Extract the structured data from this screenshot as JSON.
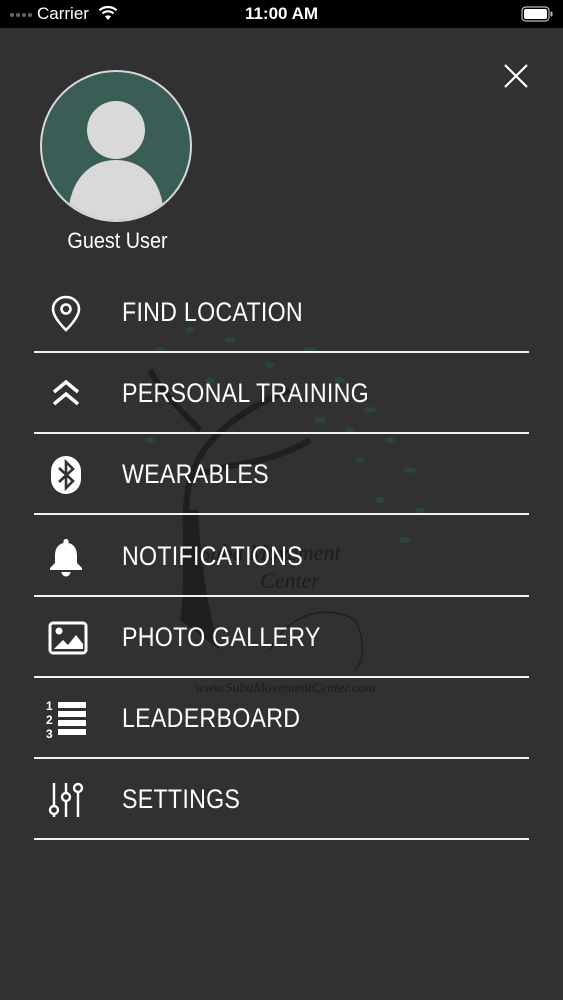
{
  "status_bar": {
    "carrier": "Carrier",
    "time": "11:00 AM"
  },
  "user": {
    "name": "Guest User"
  },
  "watermark": {
    "title_line1": "Suba Movement",
    "title_line2": "Center",
    "url": "www.SubaMovementCenter.com"
  },
  "menu": [
    {
      "label": "FIND LOCATION",
      "icon": "location-pin-icon"
    },
    {
      "label": "PERSONAL TRAINING",
      "icon": "double-chevron-up-icon"
    },
    {
      "label": "WEARABLES",
      "icon": "bluetooth-icon"
    },
    {
      "label": "NOTIFICATIONS",
      "icon": "bell-icon"
    },
    {
      "label": "PHOTO GALLERY",
      "icon": "photo-icon"
    },
    {
      "label": "LEADERBOARD",
      "icon": "ranked-list-icon"
    },
    {
      "label": "SETTINGS",
      "icon": "sliders-icon"
    }
  ],
  "colors": {
    "background": "#313133",
    "avatar_bg": "#3a5e55",
    "divider": "#f2f2f2"
  }
}
